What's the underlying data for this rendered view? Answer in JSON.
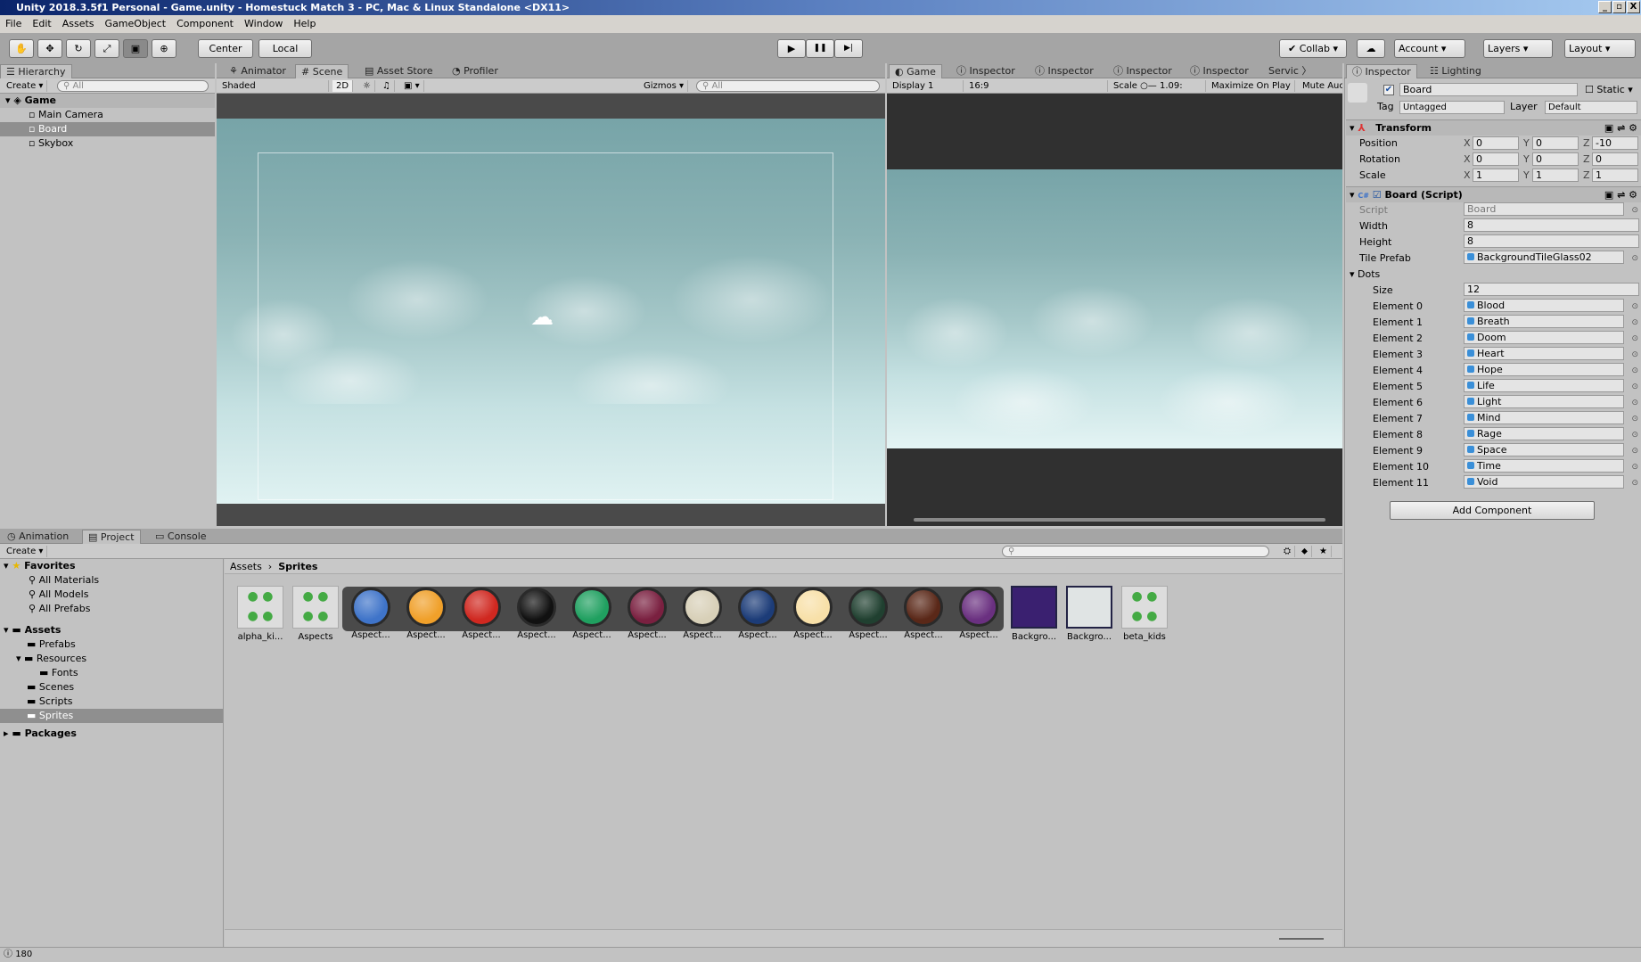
{
  "window": {
    "title": "Unity 2018.3.5f1 Personal - Game.unity - Homestuck Match 3 - PC, Mac & Linux Standalone <DX11>",
    "min": "_",
    "max": "▫",
    "close": "X"
  },
  "menu": [
    "File",
    "Edit",
    "Assets",
    "GameObject",
    "Component",
    "Window",
    "Help"
  ],
  "toolbar": {
    "tools": [
      "hand-tool",
      "move-tool",
      "rotate-tool",
      "scale-tool",
      "rect-tool",
      "transform-tool"
    ],
    "pivot": "Center",
    "space": "Local",
    "play": "▶",
    "pause": "❚❚",
    "step": "▶|",
    "collab": "Collab",
    "account": "Account",
    "layers": "Layers",
    "layout": "Layout"
  },
  "hierarchy": {
    "tab": "Hierarchy",
    "create": "Create",
    "search_placeholder": "All",
    "scene": "Game",
    "items": [
      "Main Camera",
      "Board",
      "Skybox"
    ],
    "selected": "Board"
  },
  "scene": {
    "tabs": [
      "Animator",
      "Scene",
      "Asset Store",
      "Profiler"
    ],
    "active": "Scene",
    "shading": "Shaded",
    "mode_2d": "2D",
    "gizmos": "Gizmos",
    "search_placeholder": "All"
  },
  "game": {
    "tabs": [
      "Game",
      "Inspector",
      "Inspector",
      "Inspector",
      "Inspector",
      "Servic"
    ],
    "display": "Display 1",
    "aspect": "16:9",
    "scale_label": "Scale",
    "scale_value": "1.09:",
    "maximize": "Maximize On Play",
    "mute": "Mute Auc"
  },
  "inspector": {
    "tabs": [
      "Inspector",
      "Lighting"
    ],
    "object_name": "Board",
    "active": true,
    "static_label": "Static",
    "tag_label": "Tag",
    "tag": "Untagged",
    "layer_label": "Layer",
    "layer": "Default",
    "transform": {
      "title": "Transform",
      "rows": [
        {
          "label": "Position",
          "x": "0",
          "y": "0",
          "z": "-10"
        },
        {
          "label": "Rotation",
          "x": "0",
          "y": "0",
          "z": "0"
        },
        {
          "label": "Scale",
          "x": "1",
          "y": "1",
          "z": "1"
        }
      ]
    },
    "script": {
      "title": "Board (Script)",
      "script_label": "Script",
      "script_value": "Board",
      "width_label": "Width",
      "width": "8",
      "height_label": "Height",
      "height": "8",
      "tile_label": "Tile Prefab",
      "tile": "BackgroundTileGlass02",
      "dots_label": "Dots",
      "size_label": "Size",
      "size": "12",
      "elements": [
        {
          "label": "Element 0",
          "value": "Blood"
        },
        {
          "label": "Element 1",
          "value": "Breath"
        },
        {
          "label": "Element 2",
          "value": "Doom"
        },
        {
          "label": "Element 3",
          "value": "Heart"
        },
        {
          "label": "Element 4",
          "value": "Hope"
        },
        {
          "label": "Element 5",
          "value": "Life"
        },
        {
          "label": "Element 6",
          "value": "Light"
        },
        {
          "label": "Element 7",
          "value": "Mind"
        },
        {
          "label": "Element 8",
          "value": "Rage"
        },
        {
          "label": "Element 9",
          "value": "Space"
        },
        {
          "label": "Element 10",
          "value": "Time"
        },
        {
          "label": "Element 11",
          "value": "Void"
        }
      ]
    },
    "add_component": "Add Component"
  },
  "bottom": {
    "tabs": [
      "Animation",
      "Project",
      "Console"
    ],
    "active": "Project",
    "create": "Create",
    "favorites": {
      "label": "Favorites",
      "items": [
        "All Materials",
        "All Models",
        "All Prefabs"
      ]
    },
    "assets": {
      "label": "Assets",
      "items": [
        "Prefabs",
        "Resources",
        "Fonts",
        "Scenes",
        "Scripts",
        "Sprites"
      ],
      "selected": "Sprites"
    },
    "packages": "Packages",
    "breadcrumb": [
      "Assets",
      "Sprites"
    ],
    "files": [
      {
        "name": "alpha_ki...",
        "kind": "sheet"
      },
      {
        "name": "Aspects",
        "kind": "sheet"
      },
      {
        "name": "Aspect...",
        "color": "#3f74c9"
      },
      {
        "name": "Aspect...",
        "color": "#f0a02a"
      },
      {
        "name": "Aspect...",
        "color": "#d02820"
      },
      {
        "name": "Aspect...",
        "color": "#111111"
      },
      {
        "name": "Aspect...",
        "color": "#20a060"
      },
      {
        "name": "Aspect...",
        "color": "#7a2040"
      },
      {
        "name": "Aspect...",
        "color": "#d8d0b8"
      },
      {
        "name": "Aspect...",
        "color": "#1c3c78"
      },
      {
        "name": "Aspect...",
        "color": "#f8e0a8"
      },
      {
        "name": "Aspect...",
        "color": "#204030"
      },
      {
        "name": "Aspect...",
        "color": "#5a2818"
      },
      {
        "name": "Aspect...",
        "color": "#6a3080"
      },
      {
        "name": "Backgro...",
        "color": "#3a2070"
      },
      {
        "name": "Backgro...",
        "color": "#e0e4e4"
      },
      {
        "name": "beta_kids",
        "kind": "sheet"
      }
    ]
  },
  "status": {
    "count": "180"
  }
}
